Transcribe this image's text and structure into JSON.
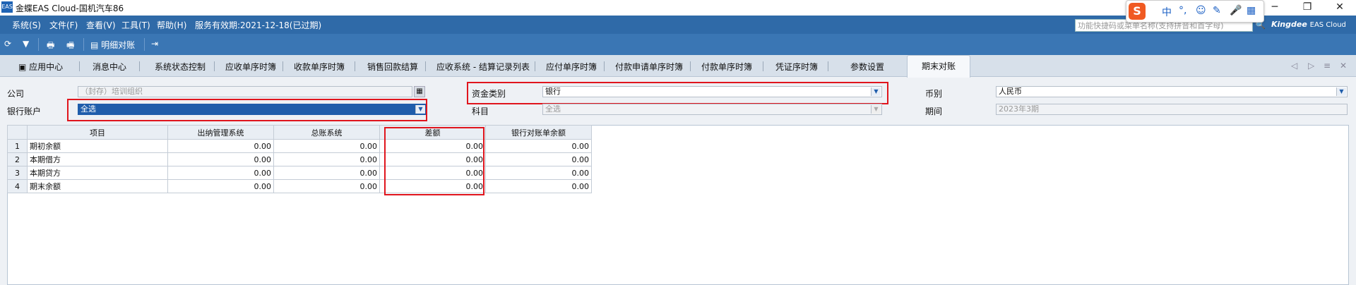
{
  "window": {
    "title": "金蝶EAS Cloud-国机汽车86",
    "logo": "EAS"
  },
  "menubar": {
    "items": [
      "系统(S)",
      "文件(F)",
      "查看(V)",
      "工具(T)",
      "帮助(H)"
    ],
    "service_status": "服务有效期:2021-12-18(已过期)",
    "search_placeholder": "功能快捷码或菜单名称(支持拼音和首字母)",
    "brand": "Kingdee",
    "brand_sub": "EAS Cloud"
  },
  "ime": {
    "logo": "S",
    "glyphs": [
      "中",
      "°,",
      "☺",
      "✎",
      "🎤",
      "▦"
    ]
  },
  "toolbar": {
    "detail_reconcile": "明细对账"
  },
  "tabs": {
    "items": [
      "应用中心",
      "消息中心",
      "系统状态控制",
      "应收单序时簿",
      "收款单序时簿",
      "销售回款结算",
      "应收系统 - 结算记录列表",
      "应付单序时簿",
      "付款申请单序时簿",
      "付款单序时簿",
      "凭证序时簿",
      "参数设置"
    ],
    "active": "期末对账"
  },
  "form": {
    "company_label": "公司",
    "company_value": "（封存）培训组织",
    "bank_account_label": "银行账户",
    "bank_account_value": "全选",
    "fund_type_label": "资金类别",
    "fund_type_value": "银行",
    "subject_label": "科目",
    "subject_value": "全选",
    "currency_label": "币别",
    "currency_value": "人民币",
    "period_label": "期间",
    "period_value": "2023年3期"
  },
  "grid": {
    "headers": [
      "项目",
      "出纳管理系统",
      "总账系统",
      "差额",
      "银行对账单余额"
    ],
    "rows": [
      {
        "n": "1",
        "item": "期初余额",
        "cashier": "0.00",
        "ledger": "0.00",
        "diff": "0.00",
        "bank": "0.00"
      },
      {
        "n": "2",
        "item": "本期借方",
        "cashier": "0.00",
        "ledger": "0.00",
        "diff": "0.00",
        "bank": "0.00"
      },
      {
        "n": "3",
        "item": "本期贷方",
        "cashier": "0.00",
        "ledger": "0.00",
        "diff": "0.00",
        "bank": "0.00"
      },
      {
        "n": "4",
        "item": "期末余额",
        "cashier": "0.00",
        "ledger": "0.00",
        "diff": "0.00",
        "bank": "0.00"
      }
    ]
  }
}
